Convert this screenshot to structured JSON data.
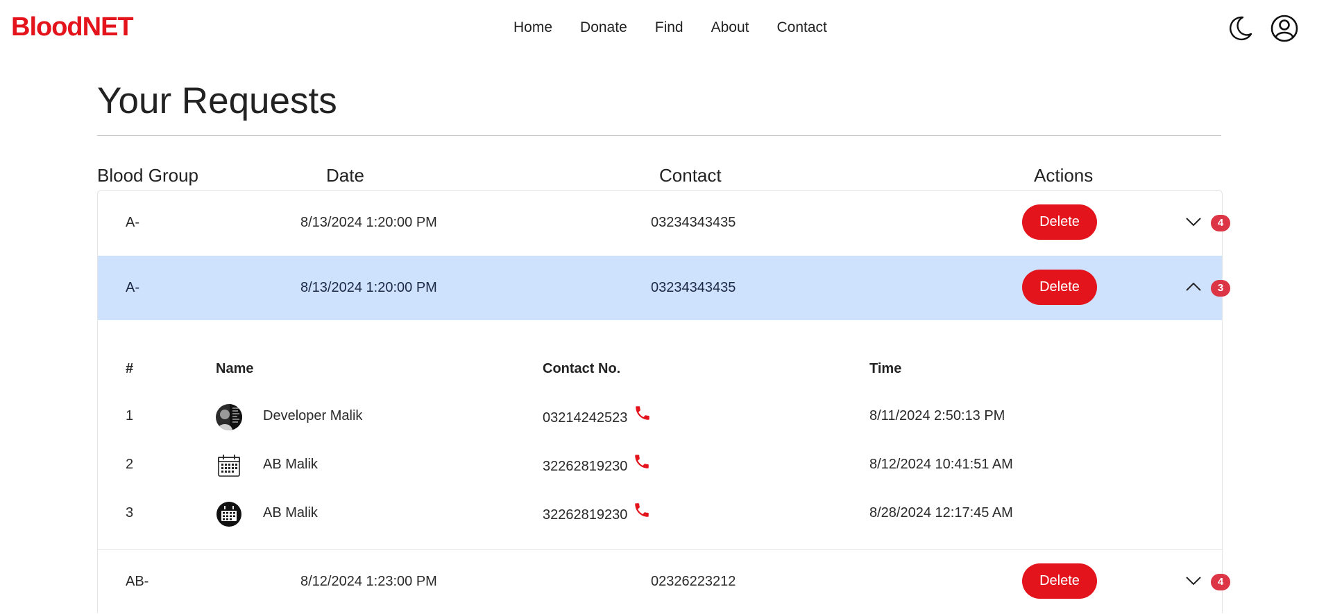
{
  "brand": "BloodNET",
  "nav": [
    "Home",
    "Donate",
    "Find",
    "About",
    "Contact"
  ],
  "icons": {
    "theme": "moon-icon",
    "user": "user-circle-icon",
    "expand": "chevron-down-icon",
    "collapse": "chevron-up-icon",
    "call": "phone-icon"
  },
  "colors": {
    "brand": "#e3141c",
    "highlight": "#cfe2fd",
    "badge": "#dc3545"
  },
  "page": {
    "title": "Your Requests"
  },
  "table": {
    "columns": [
      "Blood Group",
      "Date",
      "Contact",
      "Actions"
    ],
    "delete_label": "Delete",
    "rows": [
      {
        "blood_group": "A-",
        "date": "8/13/2024 1:20:00 PM",
        "contact": "03234343435",
        "responses": "4",
        "expanded": false
      },
      {
        "blood_group": "A-",
        "date": "8/13/2024 1:20:00 PM",
        "contact": "03234343435",
        "responses": "3",
        "expanded": true
      },
      {
        "blood_group": "AB-",
        "date": "8/12/2024 1:23:00 PM",
        "contact": "02326223212",
        "responses": "4",
        "expanded": false
      }
    ]
  },
  "responders": {
    "columns": [
      "#",
      "Name",
      "Contact No.",
      "Time"
    ],
    "rows": [
      {
        "index": "1",
        "name": "Developer Malik",
        "contact": "03214242523",
        "time": "8/11/2024 2:50:13 PM"
      },
      {
        "index": "2",
        "name": "AB Malik",
        "contact": "32262819230",
        "time": "8/12/2024 10:41:51 AM"
      },
      {
        "index": "3",
        "name": "AB Malik",
        "contact": "32262819230",
        "time": "8/28/2024 12:17:45 AM"
      }
    ]
  }
}
